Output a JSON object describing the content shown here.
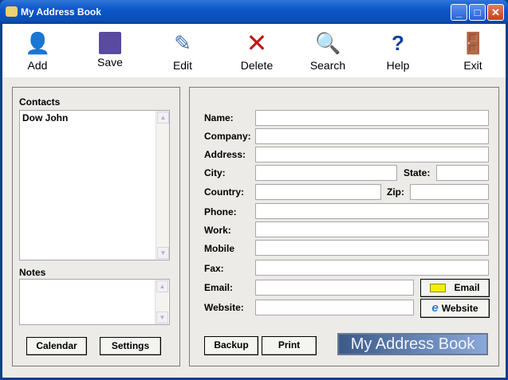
{
  "window": {
    "title": "My Address Book"
  },
  "toolbar": [
    {
      "label": "Add",
      "icon": "add-contact-icon"
    },
    {
      "label": "Save",
      "icon": "floppy-disk-icon"
    },
    {
      "label": "Edit",
      "icon": "edit-pencil-icon"
    },
    {
      "label": "Delete",
      "icon": "delete-x-icon"
    },
    {
      "label": "Search",
      "icon": "magnifier-icon"
    },
    {
      "label": "Help",
      "icon": "help-icon"
    },
    {
      "label": "Exit",
      "icon": "exit-door-icon"
    }
  ],
  "contacts": {
    "label": "Contacts",
    "items": [
      "Dow John"
    ]
  },
  "notes": {
    "label": "Notes",
    "value": ""
  },
  "left_buttons": {
    "calendar": "Calendar",
    "settings": "Settings"
  },
  "form": {
    "name": "Name:",
    "company": "Company:",
    "address": "Address:",
    "city": "City:",
    "state": "State:",
    "country": "Country:",
    "zip": "Zip:",
    "phone": "Phone:",
    "work": "Work:",
    "mobile": "Mobile",
    "fax": "Fax:",
    "email": "Email:",
    "website": "Website:"
  },
  "buttons": {
    "email": "Email",
    "website": "Website",
    "backup": "Backup",
    "print": "Print"
  },
  "logo": "My Address Book"
}
